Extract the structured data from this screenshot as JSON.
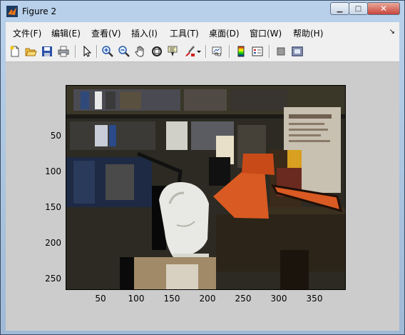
{
  "window": {
    "title": "Figure 2",
    "minimize_glyph": "▁",
    "maximize_glyph": "□",
    "close_glyph": "✕"
  },
  "menu": {
    "items": [
      "文件(F)",
      "编辑(E)",
      "查看(V)",
      "插入(I)",
      "工具(T)",
      "桌面(D)",
      "窗口(W)",
      "帮助(H)"
    ],
    "overflow_glyph": "↘"
  },
  "toolbar": {
    "icons": [
      "new-figure-icon",
      "open-file-icon",
      "save-icon",
      "print-icon",
      "edit-plot-arrow-icon",
      "zoom-in-icon",
      "zoom-out-icon",
      "pan-hand-icon",
      "rotate-3d-icon",
      "data-cursor-icon",
      "brush-icon",
      "brush-dropdown-icon",
      "link-plot-icon",
      "colorbar-icon",
      "legend-icon",
      "hide-plot-tools-icon",
      "show-plot-tools-icon"
    ]
  },
  "axes": {
    "yticks": [
      "50",
      "100",
      "150",
      "200",
      "250"
    ],
    "xticks": [
      "50",
      "100",
      "150",
      "200",
      "250",
      "300",
      "350"
    ],
    "colors": {
      "background": "#cccccc",
      "axes_border": "#000000"
    }
  }
}
